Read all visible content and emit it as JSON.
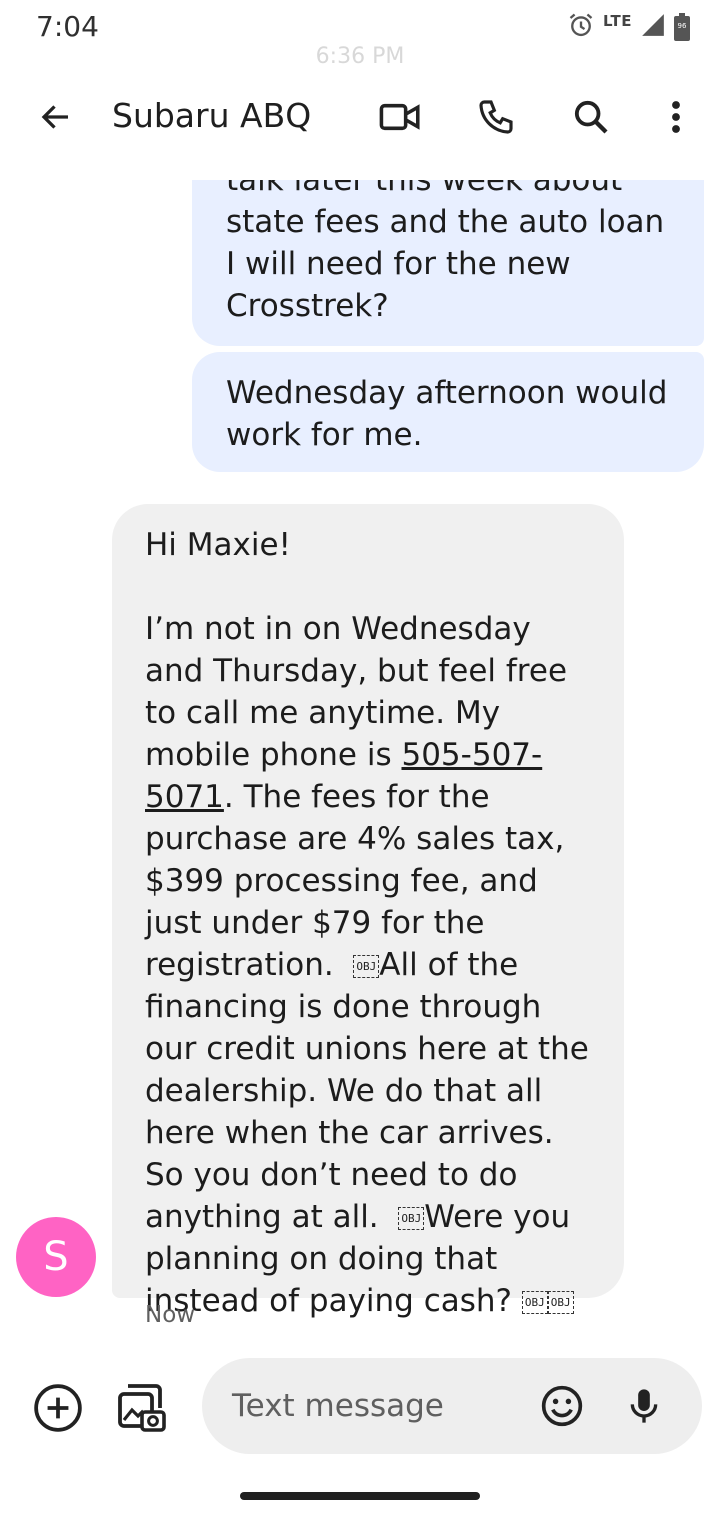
{
  "status_bar": {
    "time": "7:04",
    "network": "LTE",
    "battery": "96"
  },
  "thread": {
    "timestamp_top": "6:36 PM",
    "messages_out": [
      "Can we schedule a time to talk later this week about state fees and the auto loan I will need for the new Crosstrek?",
      "Wednesday afternoon would work for me."
    ],
    "incoming": {
      "greeting": "Hi Maxie!",
      "p1": "I’m not in on Wednesday and Thursday, but feel free to call me anytime. My mobile phone is ",
      "phone": "505-507-5071",
      "p2": ". The fees for the purchase are 4% sales tax, $399 processing fee, and just under $79 for the registration.  ",
      "obj_label": "OBJ",
      "p3": "All of the financing is done through our credit unions here at the dealership. We do that all here when the car arrives. So you don’t need to do anything at all.  ",
      "p4": "Were you planning on doing that instead of paying cash? ",
      "sender_initial": "S",
      "time": "Now"
    }
  },
  "app_bar": {
    "title": "Subaru ABQ"
  },
  "compose": {
    "placeholder": "Text message"
  },
  "icons": {
    "back": "arrow-back-icon",
    "video": "video-call-icon",
    "call": "phone-icon",
    "search": "search-icon",
    "menu": "more-vert-icon",
    "add": "add-circle-icon",
    "gallery": "gallery-icon",
    "emoji": "emoji-icon",
    "mic": "mic-icon"
  },
  "colors": {
    "outgoing_bubble": "#e8efff",
    "incoming_bubble": "#f0f0f0",
    "avatar": "#ff63c4"
  }
}
